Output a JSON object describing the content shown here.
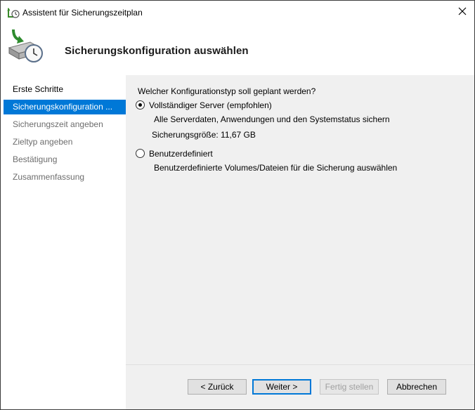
{
  "window": {
    "title": "Assistent für Sicherungszeitplan",
    "header_title": "Sicherungskonfiguration auswählen"
  },
  "sidebar": {
    "items": [
      {
        "label": "Erste Schritte",
        "state": "visited"
      },
      {
        "label": "Sicherungskonfiguration ...",
        "state": "active"
      },
      {
        "label": "Sicherungszeit angeben",
        "state": "pending"
      },
      {
        "label": "Zieltyp angeben",
        "state": "pending"
      },
      {
        "label": "Bestätigung",
        "state": "pending"
      },
      {
        "label": "Zusammenfassung",
        "state": "pending"
      }
    ]
  },
  "content": {
    "question": "Welcher Konfigurationstyp soll geplant werden?",
    "options": [
      {
        "label": "Vollständiger Server (empfohlen)",
        "description": "Alle Serverdaten, Anwendungen und den Systemstatus sichern",
        "size_text": "Sicherungsgröße: 11,67 GB",
        "selected": true
      },
      {
        "label": "Benutzerdefiniert",
        "description": "Benutzerdefinierte Volumes/Dateien für die Sicherung auswählen",
        "selected": false
      }
    ]
  },
  "buttons": {
    "back": "< Zurück",
    "next": "Weiter >",
    "finish": "Fertig stellen",
    "cancel": "Abbrechen"
  },
  "icons": {
    "title": "backup-schedule-icon",
    "header": "backup-drive-clock-icon",
    "close": "close-icon"
  },
  "colors": {
    "accent": "#0078d7",
    "content_bg": "#f0f0f0",
    "disabled_text": "#a0a0a0"
  }
}
